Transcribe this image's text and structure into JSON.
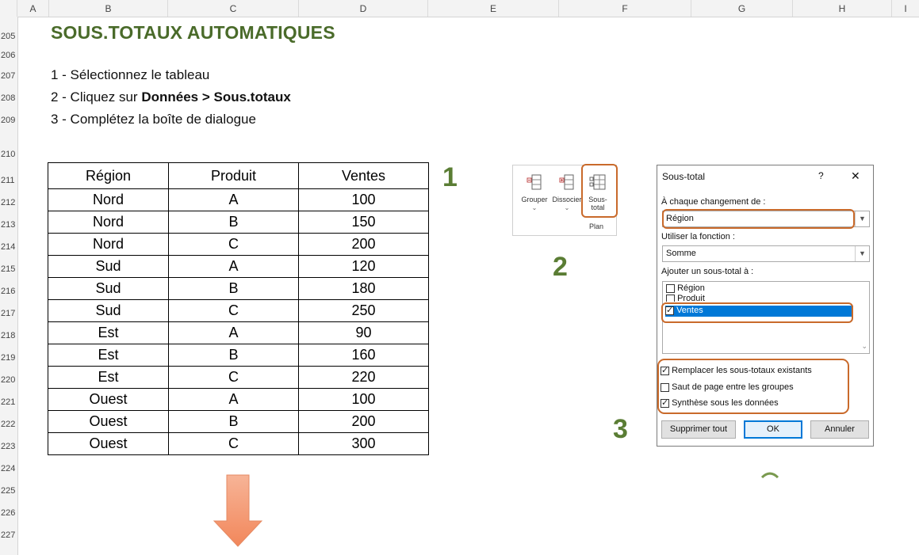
{
  "columns": [
    "A",
    "B",
    "C",
    "D",
    "E",
    "F",
    "G",
    "H",
    "I"
  ],
  "rows": [
    "205",
    "206",
    "207",
    "208",
    "209",
    "210",
    "211",
    "212",
    "213",
    "214",
    "215",
    "216",
    "217",
    "218",
    "219",
    "220",
    "221",
    "222",
    "223",
    "224",
    "225",
    "226",
    "227"
  ],
  "title": "SOUS.TOTAUX AUTOMATIQUES",
  "steps": {
    "s1": "1 - Sélectionnez le tableau",
    "s2_pre": "2 - Cliquez sur ",
    "s2_bold": "Données > Sous.totaux",
    "s3": "3 - Complétez la boîte de dialogue"
  },
  "table": {
    "headers": [
      "Région",
      "Produit",
      "Ventes"
    ],
    "rows": [
      [
        "Nord",
        "A",
        "100"
      ],
      [
        "Nord",
        "B",
        "150"
      ],
      [
        "Nord",
        "C",
        "200"
      ],
      [
        "Sud",
        "A",
        "120"
      ],
      [
        "Sud",
        "B",
        "180"
      ],
      [
        "Sud",
        "C",
        "250"
      ],
      [
        "Est",
        "A",
        "90"
      ],
      [
        "Est",
        "B",
        "160"
      ],
      [
        "Est",
        "C",
        "220"
      ],
      [
        "Ouest",
        "A",
        "100"
      ],
      [
        "Ouest",
        "B",
        "200"
      ],
      [
        "Ouest",
        "C",
        "300"
      ]
    ]
  },
  "markers": {
    "one": "1",
    "two": "2",
    "three": "3"
  },
  "ribbon": {
    "grouper": "Grouper",
    "dissocier": "Dissocier",
    "soustotal_1": "Sous-",
    "soustotal_2": "total",
    "group_label": "Plan"
  },
  "dialog": {
    "title": "Sous-total",
    "help": "?",
    "close": "✕",
    "change_label": "À chaque changement de :",
    "change_value": "Région",
    "function_label": "Utiliser la fonction :",
    "function_value": "Somme",
    "add_label": "Ajouter un sous-total à :",
    "fields": [
      "Région",
      "Produit",
      "Ventes"
    ],
    "fields_checked": [
      false,
      false,
      true
    ],
    "opt_replace": "Remplacer les sous-totaux existants",
    "opt_pagebreak": "Saut de page entre les groupes",
    "opt_summary": "Synthèse sous les données",
    "btn_remove": "Supprimer tout",
    "btn_ok": "OK",
    "btn_cancel": "Annuler"
  },
  "colors": {
    "accent": "#4a6b2a",
    "highlight": "#c96a2b",
    "selection": "#0078d7",
    "arrow": "#f4a07a"
  }
}
